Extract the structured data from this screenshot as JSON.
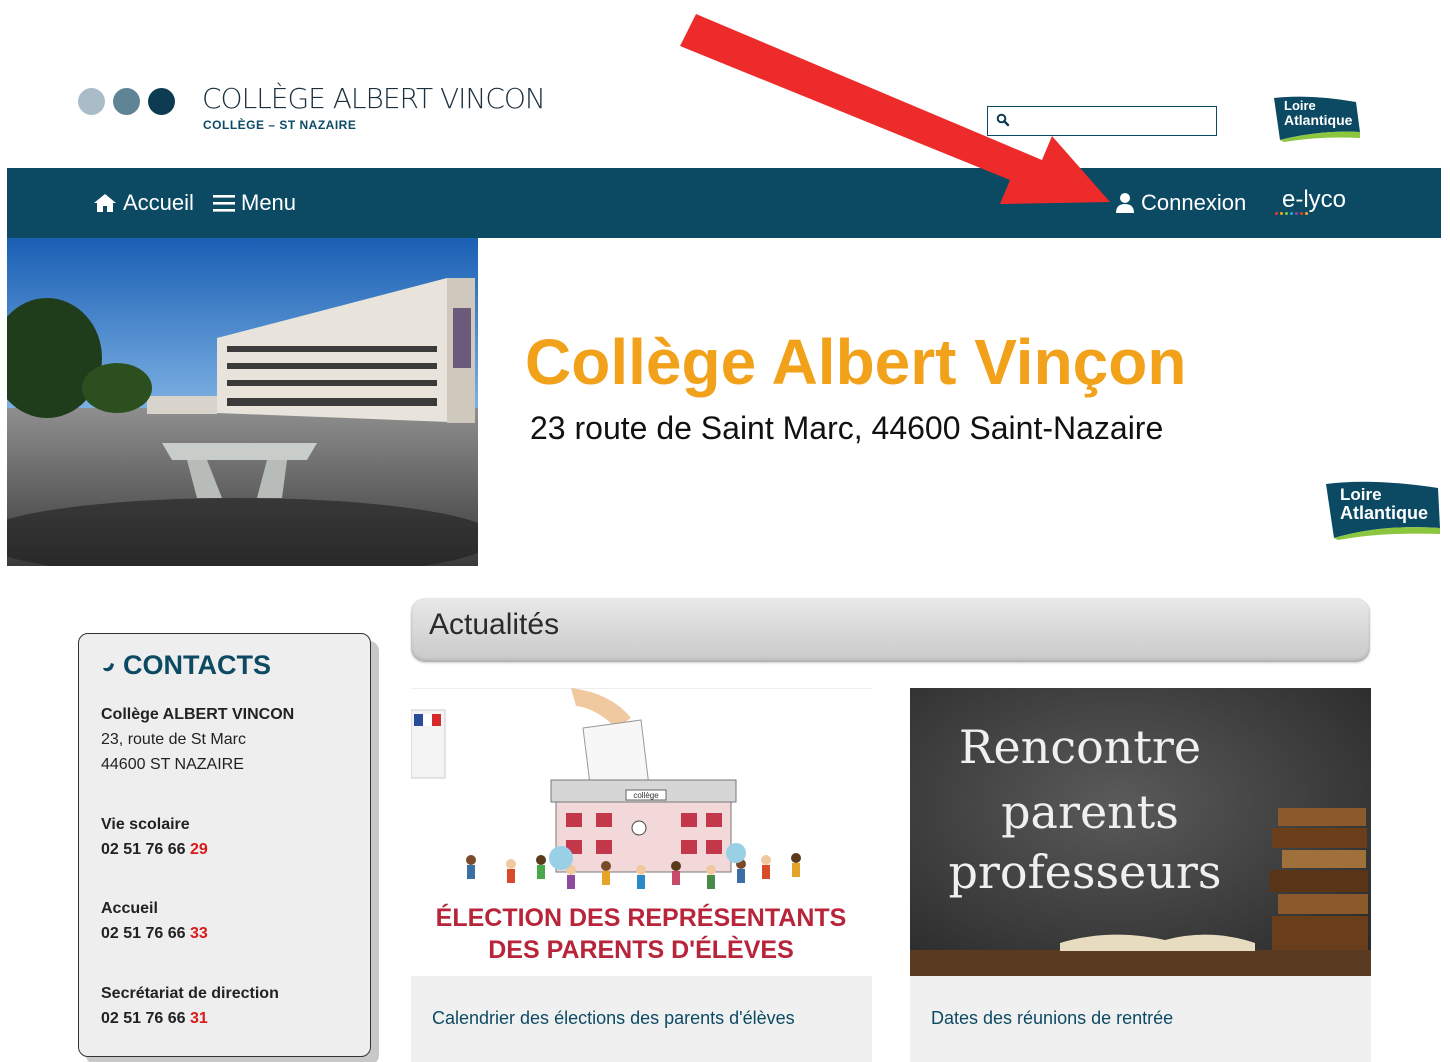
{
  "header": {
    "title": "COLLÈGE ALBERT VINCON",
    "subtitle": "COLLÈGE – ST NAZAIRE",
    "logo_dot_colors": [
      "#a9bcc8",
      "#5f8496",
      "#0c3b52"
    ],
    "search_placeholder": "",
    "partner_logo_line1": "Loire",
    "partner_logo_line2": "Atlantique"
  },
  "nav": {
    "home_label": "Accueil",
    "menu_label": "Menu",
    "login_label": "Connexion",
    "elyco_label": "e-lyco",
    "background": "#0c4a63"
  },
  "banner": {
    "title": "Collège Albert Vinçon",
    "address": "23 route de Saint Marc, 44600 Saint-Nazaire",
    "logo_line1": "Loire",
    "logo_line2": "Atlantique",
    "title_color": "#f2a11a"
  },
  "contacts": {
    "title": "CONTACTS",
    "school_name": "Collège ALBERT VINCON",
    "address_line1": "23, route de St Marc",
    "address_line2": "44600 ST NAZAIRE",
    "entries": [
      {
        "label": "Vie scolaire",
        "number_prefix": "02 51 76 66 ",
        "number_suffix": "29"
      },
      {
        "label": "Accueil",
        "number_prefix": "02 51 76 66 ",
        "number_suffix": "33"
      },
      {
        "label": "Secrétariat de direction",
        "number_prefix": "02 51 76 66 ",
        "number_suffix": "31"
      }
    ]
  },
  "news": {
    "section_title": "Actualités",
    "items": [
      {
        "caption": "Calendrier des élections des parents d'élèves",
        "image_line1": "ÉLECTION DES REPRÉSENTANTS",
        "image_line2": "DES PARENTS D'ÉLÈVES",
        "image_label": "collège"
      },
      {
        "caption": "Dates des réunions de rentrée",
        "image_line1": "Rencontre",
        "image_line2": "parents",
        "image_line3": "professeurs"
      }
    ]
  },
  "annotation": {
    "arrow_color": "#ee2b2b"
  }
}
